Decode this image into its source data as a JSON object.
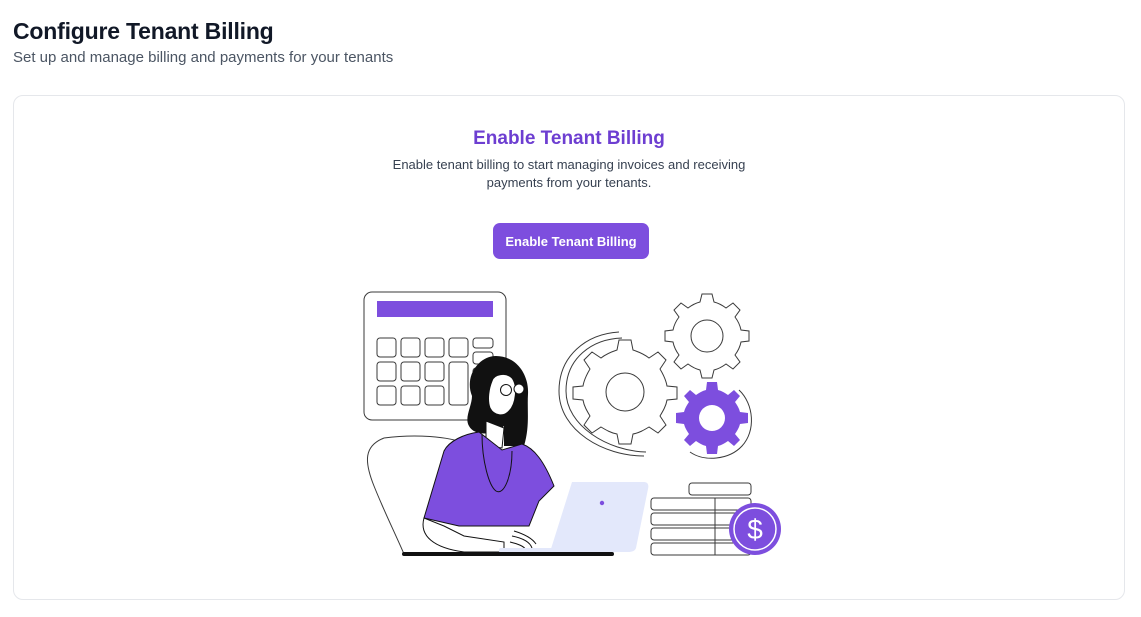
{
  "header": {
    "title": "Configure Tenant Billing",
    "subtitle": "Set up and manage billing and payments for your tenants"
  },
  "card": {
    "title": "Enable Tenant Billing",
    "description": "Enable tenant billing to start managing invoices and receiving payments from your tenants.",
    "button_label": "Enable Tenant Billing"
  },
  "illustration": {
    "icons": [
      "calculator-icon",
      "gear-icon",
      "dollar-coin-icon",
      "laptop-icon",
      "coin-stack-icon"
    ]
  },
  "colors": {
    "accent": "#7d4ede",
    "accent_text": "#6d3ed1",
    "title_text": "#111827",
    "subtitle_text": "#4b5563"
  }
}
